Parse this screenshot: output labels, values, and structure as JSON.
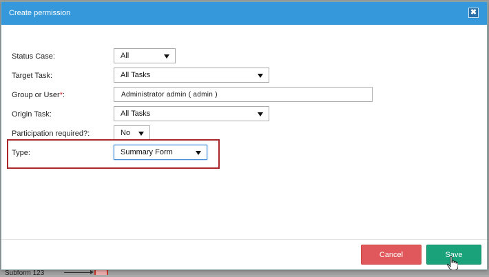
{
  "dialog": {
    "title": "Create permission",
    "close_glyph": "✖"
  },
  "form": {
    "status_case": {
      "label": "Status Case:",
      "value": "All"
    },
    "target_task": {
      "label": "Target Task:",
      "value": "All Tasks"
    },
    "group_or_user": {
      "label": "Group or User",
      "required_mark": "*",
      "label_suffix": ":",
      "value": "Administrator admin ( admin )"
    },
    "origin_task": {
      "label": "Origin Task:",
      "value": "All Tasks"
    },
    "participation": {
      "label": "Participation required?:",
      "value": "No"
    },
    "type": {
      "label": "Type:",
      "value": "Summary Form"
    }
  },
  "footer": {
    "cancel_label": "Cancel",
    "save_label": "Save"
  },
  "background": {
    "partial_text": "Subform 123"
  },
  "colors": {
    "header": "#3498db",
    "cancel": "#e0585b",
    "save": "#1aa37a",
    "highlight": "#a8262a"
  }
}
